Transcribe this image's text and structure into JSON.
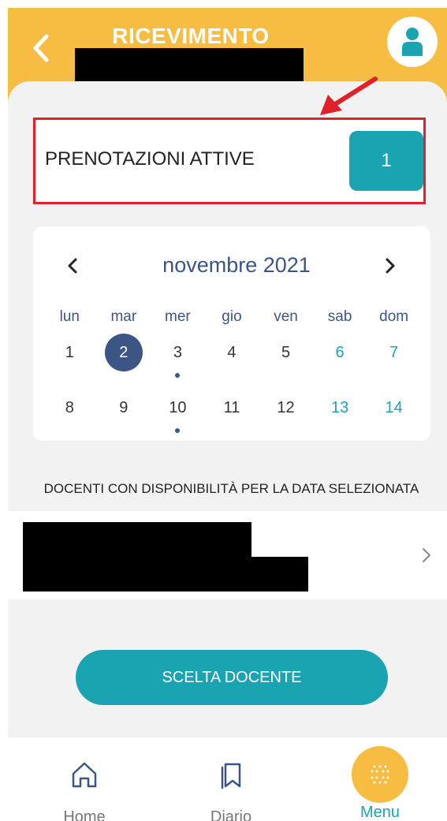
{
  "header": {
    "title": "RICEVIMENTO",
    "back_icon": "chevron-left-icon",
    "avatar_icon": "user-icon",
    "background_color": "#f7bd42"
  },
  "prenotazioni": {
    "label": "PRENOTAZIONI ATTIVE",
    "count": "1",
    "highlight_color": "#e2202a"
  },
  "calendar": {
    "month_label": "novembre 2021",
    "weekdays": [
      "lun",
      "mar",
      "mer",
      "gio",
      "ven",
      "sab",
      "dom"
    ],
    "weeks": [
      [
        "1",
        "2",
        "3",
        "4",
        "5",
        "6",
        "7"
      ],
      [
        "8",
        "9",
        "10",
        "11",
        "12",
        "13",
        "14"
      ]
    ],
    "selected_day": "2",
    "days_with_availability": [
      "3",
      "10"
    ],
    "accent_color": "#3c5585",
    "weekend_color": "#1aa3b1"
  },
  "section": {
    "label": "DOCENTI CON DISPONIBILITÀ PER LA DATA SELEZIONATA"
  },
  "cta": {
    "label": "SCELTA DOCENTE",
    "color": "#1aa3b1"
  },
  "bottom_nav": {
    "items": [
      {
        "label": "Home",
        "icon": "home-icon"
      },
      {
        "label": "Diario",
        "icon": "bookmarks-icon"
      },
      {
        "label": "Menu",
        "icon": "grid-dots-icon"
      }
    ]
  }
}
